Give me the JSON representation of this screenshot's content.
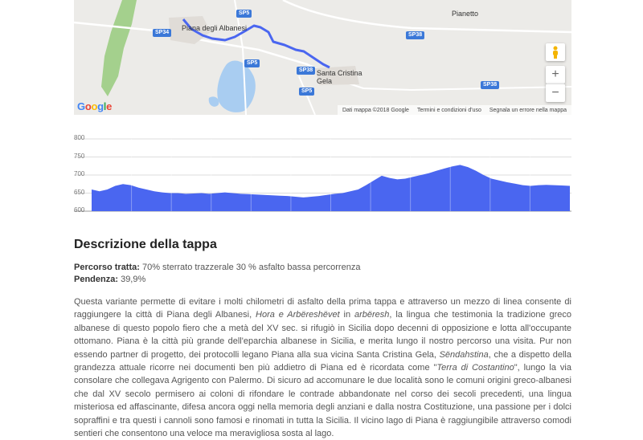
{
  "map": {
    "labels": {
      "piana": "Piana degli Albanesi",
      "santa": "Santa Cristina Gela",
      "pianetto": "Pianetto"
    },
    "roads": [
      "SP34",
      "SP5",
      "SP38",
      "SP5",
      "SP38",
      "SP5",
      "SP38"
    ],
    "zoom_in": "+",
    "zoom_out": "−",
    "logo": "Google",
    "footer": {
      "data": "Dati mappa ©2018 Google",
      "terms": "Termini e condizioni d'uso",
      "report": "Segnala un errore nella mappa"
    },
    "colors": {
      "route": "#4a66f0",
      "water": "#a9cdf1",
      "park": "#a4d08d"
    }
  },
  "elevation": {
    "yticks": [
      "800",
      "750",
      "700",
      "650",
      "600"
    ],
    "ymin": 600,
    "ymax": 800,
    "fill_color": "#4a66f0",
    "values": [
      660,
      655,
      660,
      670,
      675,
      672,
      665,
      660,
      655,
      652,
      650,
      650,
      648,
      649,
      650,
      648,
      650,
      652,
      650,
      648,
      647,
      646,
      645,
      644,
      643,
      642,
      640,
      638,
      640,
      642,
      645,
      648,
      650,
      655,
      660,
      672,
      685,
      698,
      692,
      688,
      690,
      695,
      700,
      705,
      712,
      718,
      724,
      728,
      722,
      712,
      700,
      690,
      685,
      680,
      676,
      672,
      670,
      672,
      673,
      672,
      671,
      670
    ]
  },
  "description": {
    "title": "Descrizione della tappa",
    "percorso_label": "Percorso tratta:",
    "percorso_value": " 70% sterrato trazzerale 30 % asfalto bassa percorrenza",
    "pendenza_label": "Pendenza:",
    "pendenza_value": " 39,9%",
    "p1": "Questa variante permette di evitare i molti chilometri di asfalto della prima tappa e attraverso un mezzo di linea consente di raggiungere la città di Piana degli Albanesi, ",
    "p1_it1": "Hora e Arbëreshëvet",
    "p1_b": " in ",
    "p1_it2": "arbëresh",
    "p1_c": ", la lingua che testimonia la tradizione greco albanese di questo popolo fiero che a metà del XV sec. si rifugiò in Sicilia dopo decenni di opposizione e lotta all'occupante ottomano. Piana è la città più grande dell'eparchia albanese in Sicilia, e merita lungo il nostro percorso una visita. Pur non essendo partner di progetto, dei protocolli legano Piana alla sua vicina Santa Cristina Gela, ",
    "p1_it3": "Sëndahstina",
    "p1_d": ", che a dispetto della grandezza attuale ricorre nei documenti ben più addietro di Piana ed è ricordata come \"",
    "p1_it4": "Terra di Costantino",
    "p1_e": "\", lungo la via consolare che collegava Agrigento con Palermo. Di sicuro ad accomunare le due località sono le comuni origini greco-albanesi che dal XV secolo permisero ai coloni di rifondare le contrade abbandonate nel corso dei secoli precedenti, una lingua misteriosa ed affascinante, difesa ancora oggi nella memoria degli anziani e dalla nostra Costituzione, una passione per i dolci sopraffini e tra questi i cannoli sono famosi e rinomati in tutta la Sicilia. Il vicino lago di Piana è raggiungibile attraverso comodi sentieri che consentono una veloce ma meravigliosa sosta al lago."
  }
}
